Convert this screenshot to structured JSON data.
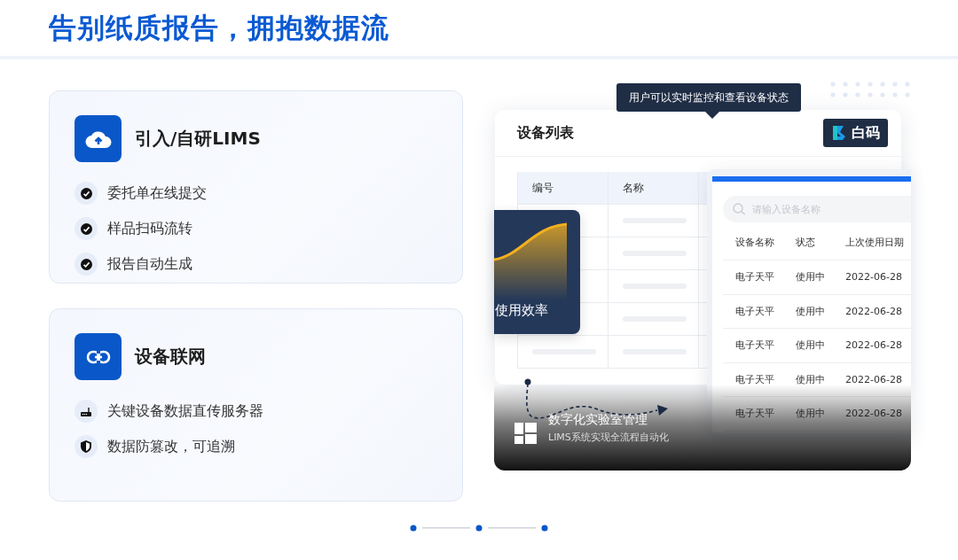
{
  "title": "告别纸质报告，拥抱数据流",
  "features": [
    {
      "kind": "upload",
      "title": "引入/自研LIMS",
      "items": [
        {
          "kind": "check",
          "text": "委托单在线提交"
        },
        {
          "kind": "check",
          "text": "样品扫码流转"
        },
        {
          "kind": "check",
          "text": "报告自动生成"
        }
      ]
    },
    {
      "kind": "link",
      "title": "设备联网",
      "items": [
        {
          "kind": "router",
          "text": "关键设备数据直传服务器"
        },
        {
          "kind": "shield",
          "text": "数据防篡改，可追溯"
        }
      ]
    }
  ],
  "mockup": {
    "tooltip": "用户可以实时监控和查看设备状态",
    "panel_title": "设备列表",
    "logo": "白码",
    "table": {
      "columns": [
        "编号",
        "名称"
      ]
    },
    "chart_card": {
      "label": "使用效率"
    },
    "device_panel": {
      "search": {
        "placeholder": "请输入设备名称"
      },
      "columns": [
        "设备名称",
        "状态",
        "上次使用日期"
      ],
      "rows": [
        {
          "name": "电子天平",
          "status": "使用中",
          "date": "2022-06-28"
        },
        {
          "name": "电子天平",
          "status": "使用中",
          "date": "2022-06-28"
        },
        {
          "name": "电子天平",
          "status": "使用中",
          "date": "2022-06-28"
        },
        {
          "name": "电子天平",
          "status": "使用中",
          "date": "2022-06-28"
        },
        {
          "name": "电子天平",
          "status": "使用中",
          "date": "2022-06-28"
        }
      ]
    },
    "caption": {
      "title": "数字化实验室管理",
      "subtitle": "LIMS系统实现全流程自动化"
    }
  }
}
